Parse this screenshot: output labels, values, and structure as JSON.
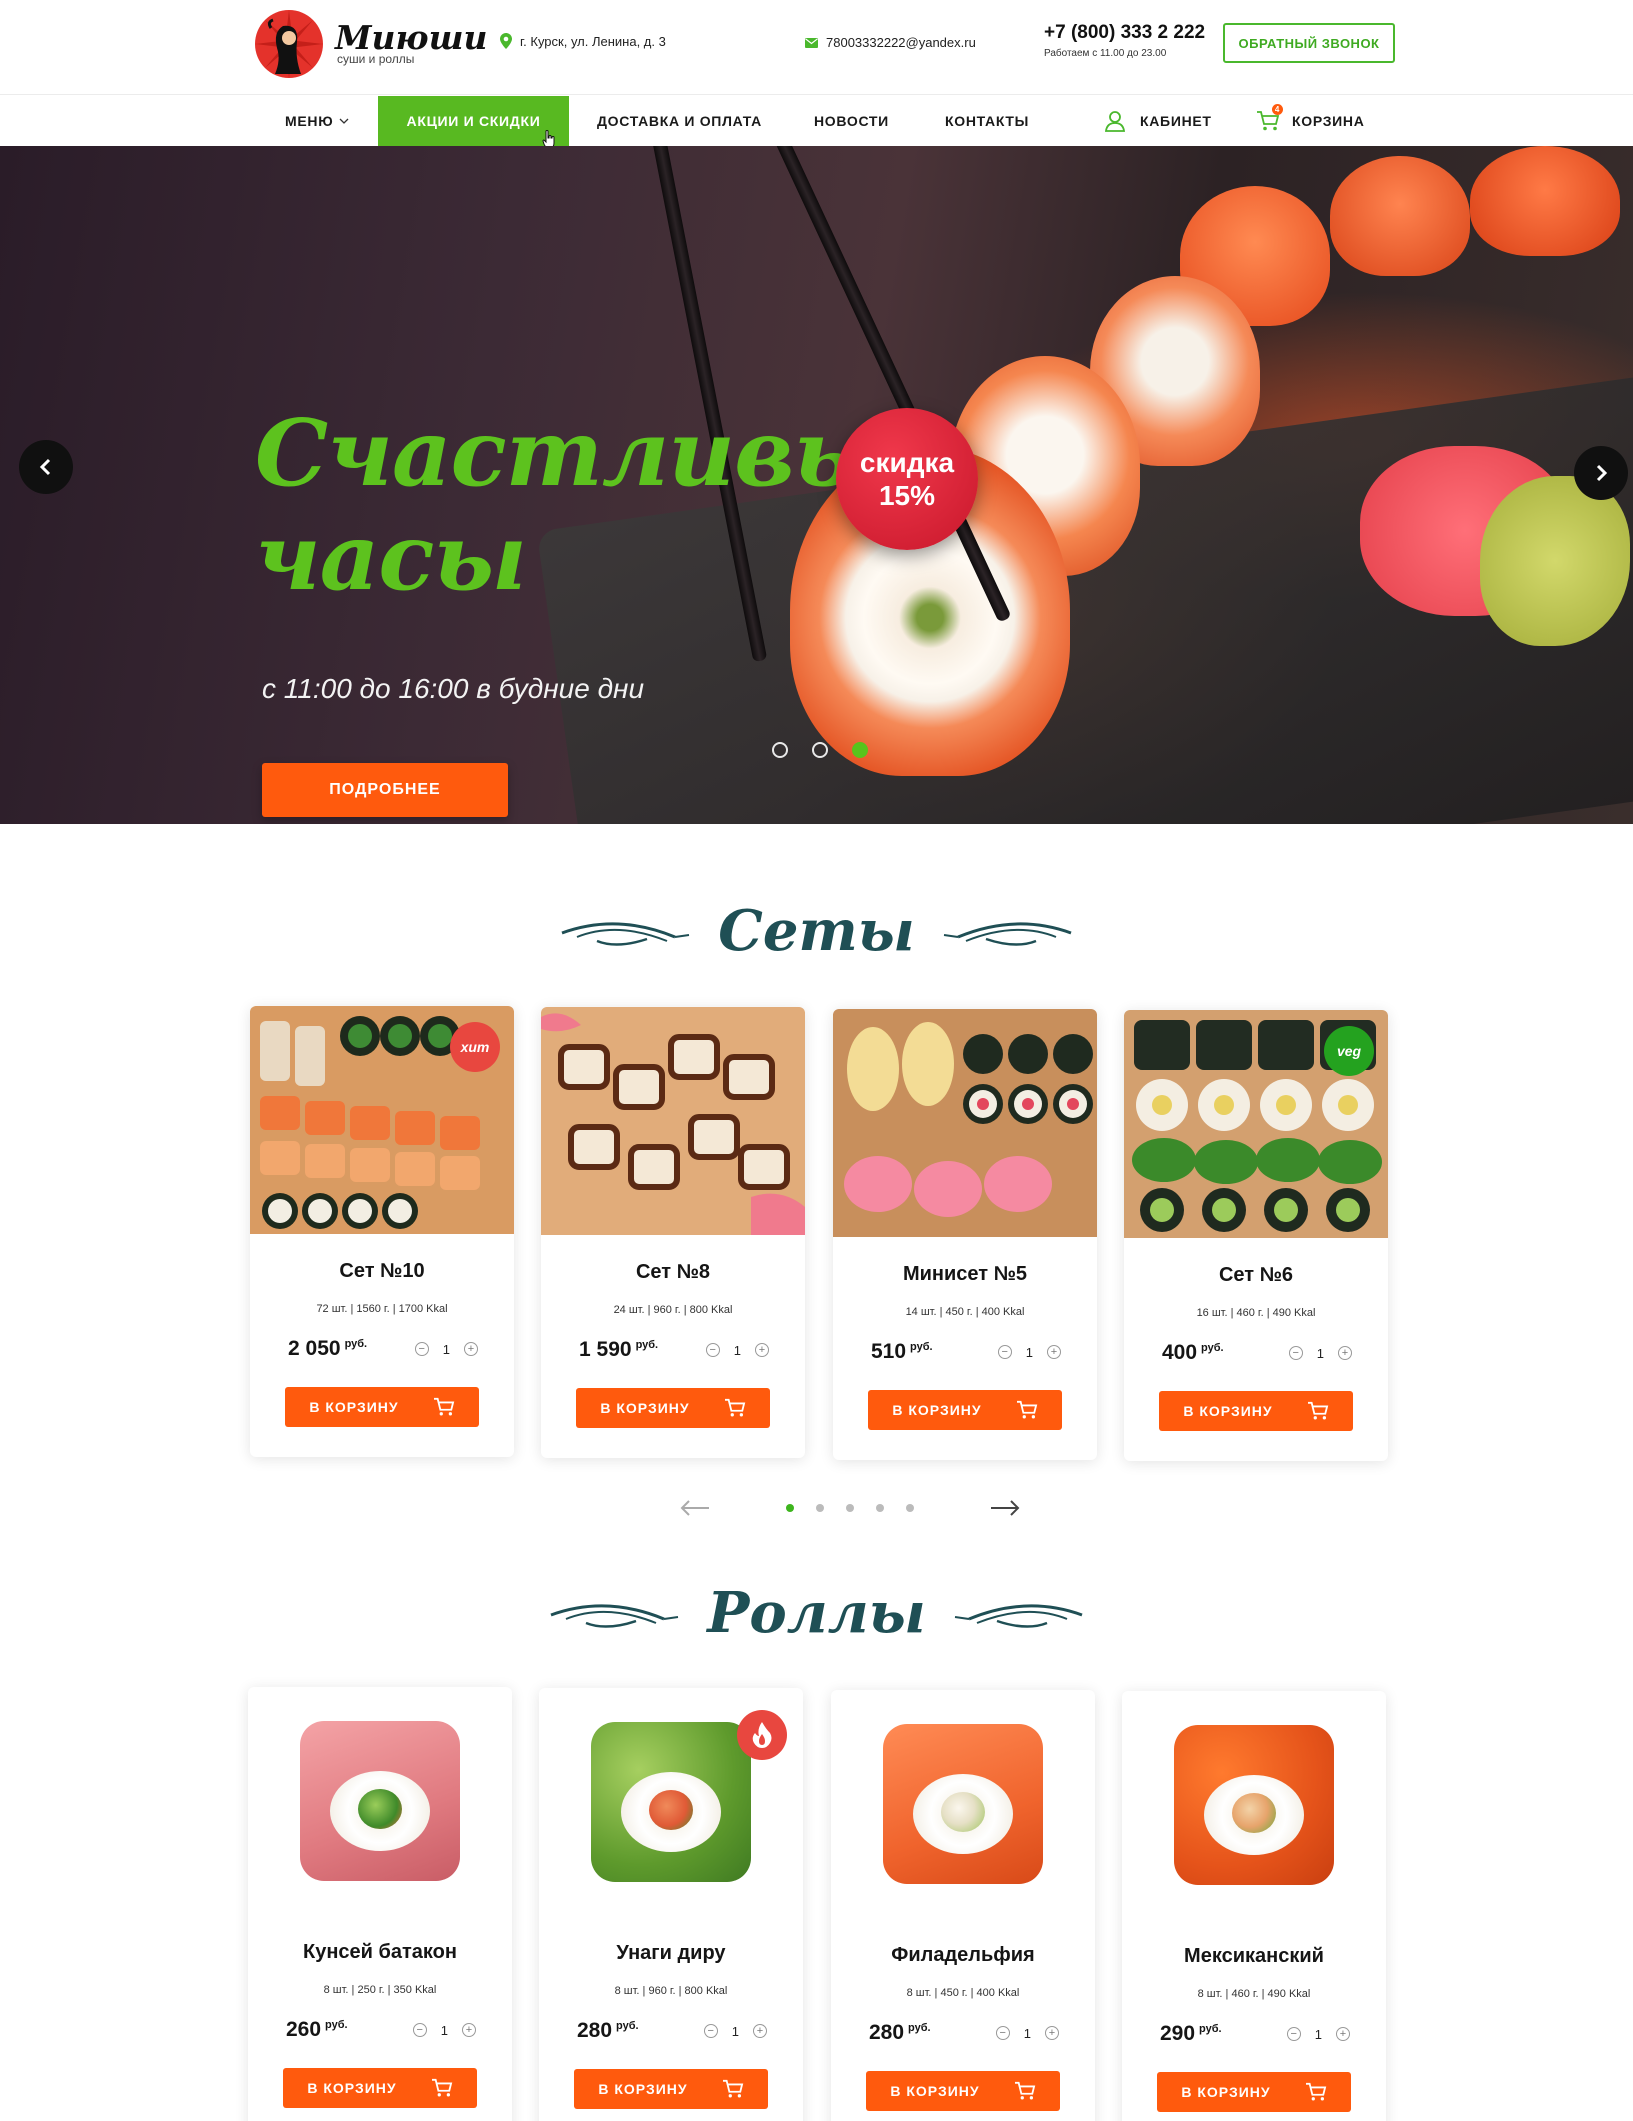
{
  "brand": {
    "name": "Миюши",
    "tagline": "суши и роллы"
  },
  "header": {
    "address": "г. Курск, ул. Ленина, д. 3",
    "email": "78003332222@yandex.ru",
    "phone": "+7 (800) 333 2 222",
    "hours": "Работаем с 11.00 до 23.00",
    "callback_label": "ОБРАТНЫЙ ЗВОНОК"
  },
  "nav": {
    "items": [
      {
        "label": "МЕНЮ"
      },
      {
        "label": "АКЦИИ И СКИДКИ",
        "active": true
      },
      {
        "label": "ДОСТАВКА И ОПЛАТА"
      },
      {
        "label": "НОВОСТИ"
      },
      {
        "label": "КОНТАКТЫ"
      }
    ],
    "cabinet_label": "КАБИНЕТ",
    "cart_label": "КОРЗИНА",
    "cart_count": "4"
  },
  "hero": {
    "title_line1": "Счастливые",
    "title_line2": "часы",
    "subtitle": "с 11:00 до 16:00 в будние дни",
    "button_label": "ПОДРОБНЕЕ",
    "badge_line1": "скидка",
    "badge_line2": "15%",
    "active_slide": 3,
    "slides_count": 3
  },
  "sets_section": {
    "title": "Сеты",
    "cards": [
      {
        "name": "Сет №10",
        "meta": "72 шт. | 1560 г. | 1700 Kkal",
        "price": "2 050",
        "currency": "руб.",
        "qty": "1",
        "badge": "хит",
        "button": "В КОРЗИНУ"
      },
      {
        "name": "Сет №8",
        "meta": "24 шт. | 960 г. | 800 Kkal",
        "price": "1 590",
        "currency": "руб.",
        "qty": "1",
        "badge": "",
        "button": "В КОРЗИНУ"
      },
      {
        "name": "Минисет №5",
        "meta": "14 шт. | 450 г. | 400 Kkal",
        "price": "510",
        "currency": "руб.",
        "qty": "1",
        "badge": "",
        "button": "В КОРЗИНУ"
      },
      {
        "name": "Сет №6",
        "meta": "16 шт. | 460 г. | 490 Kkal",
        "price": "400",
        "currency": "руб.",
        "qty": "1",
        "badge": "veg",
        "button": "В КОРЗИНУ"
      }
    ],
    "pager_pages": 5,
    "pager_active": 1
  },
  "rolls_section": {
    "title": "Роллы",
    "cards": [
      {
        "name": "Кунсей батакон",
        "meta": "8 шт. | 250 г. | 350 Kkal",
        "price": "260",
        "currency": "руб.",
        "qty": "1",
        "button": "В КОРЗИНУ"
      },
      {
        "name": "Унаги диру",
        "meta": "8 шт. | 960 г. | 800 Kkal",
        "price": "280",
        "currency": "руб.",
        "qty": "1",
        "button": "В КОРЗИНУ",
        "badge_icon": "fire-icon"
      },
      {
        "name": "Филадельфия",
        "meta": "8 шт. | 450 г. | 400 Kkal",
        "price": "280",
        "currency": "руб.",
        "qty": "1",
        "button": "В КОРЗИНУ"
      },
      {
        "name": "Мексиканский",
        "meta": "8 шт. | 460 г. | 490 Kkal",
        "price": "290",
        "currency": "руб.",
        "qty": "1",
        "button": "В КОРЗИНУ"
      }
    ]
  },
  "colors": {
    "accent_green": "#58b921",
    "accent_orange": "#ff5a0d",
    "badge_red": "#e32a3c",
    "title_teal": "#1f4f55"
  }
}
